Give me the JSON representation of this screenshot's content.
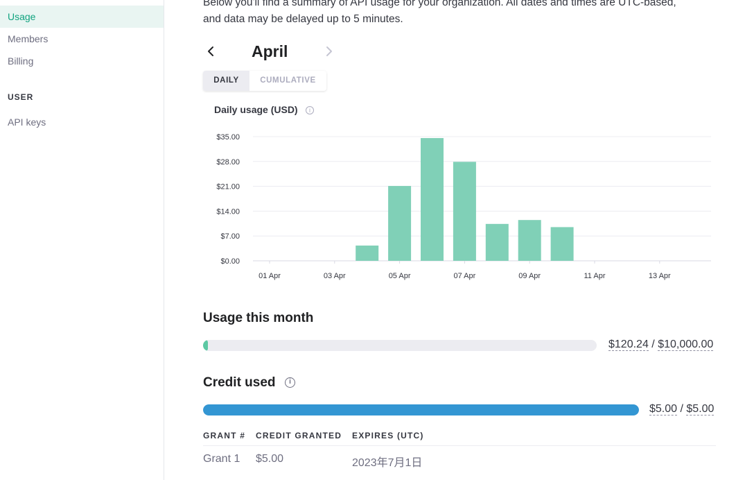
{
  "sidebar": {
    "items": [
      {
        "label": "Usage",
        "active": true
      },
      {
        "label": "Members",
        "active": false
      },
      {
        "label": "Billing",
        "active": false
      }
    ],
    "user_heading": "USER",
    "user_items": [
      {
        "label": "API keys"
      }
    ]
  },
  "intro": {
    "line1": "Below you'll find a summary of API usage for your organization. All dates and times are UTC-based,",
    "line2": "and data may be delayed up to 5 minutes."
  },
  "month_nav": {
    "prev_icon": "chevron-left-icon",
    "next_icon": "chevron-right-icon",
    "month": "April"
  },
  "view_toggle": {
    "options": [
      "DAILY",
      "CUMULATIVE"
    ],
    "selected": "DAILY"
  },
  "chart_data": {
    "type": "bar",
    "title": "Daily usage (USD)",
    "categories": [
      "01 Apr",
      "02 Apr",
      "03 Apr",
      "04 Apr",
      "05 Apr",
      "06 Apr",
      "07 Apr",
      "08 Apr",
      "09 Apr",
      "10 Apr",
      "11 Apr",
      "12 Apr",
      "13 Apr",
      "14 Apr"
    ],
    "x_tick_labels": [
      "01 Apr",
      "03 Apr",
      "05 Apr",
      "07 Apr",
      "09 Apr",
      "11 Apr",
      "13 Apr"
    ],
    "values": [
      0,
      0,
      0,
      4.3,
      21.1,
      34.6,
      27.9,
      10.4,
      11.5,
      9.5,
      0,
      0,
      0,
      0
    ],
    "y_ticks": [
      "$0.00",
      "$7.00",
      "$14.00",
      "$21.00",
      "$28.00",
      "$35.00"
    ],
    "ylim": [
      0,
      35
    ],
    "xlabel": "",
    "ylabel": "",
    "grid": true,
    "bar_color": "#80d0b7"
  },
  "usage_month": {
    "title": "Usage this month",
    "used": "$120.24",
    "limit": "$10,000.00",
    "separator": "/",
    "fraction": 0.012,
    "fill_color": "#5cc8a3"
  },
  "credit": {
    "title": "Credit used",
    "info_icon": "info-icon",
    "used": "$5.00",
    "total": "$5.00",
    "separator": "/",
    "fraction": 1.0,
    "fill_color": "#3396d3"
  },
  "grants": {
    "headers": [
      "GRANT #",
      "CREDIT GRANTED",
      "EXPIRES (UTC)"
    ],
    "rows": [
      [
        "Grant 1",
        "$5.00",
        "2023年7月1日"
      ]
    ]
  }
}
